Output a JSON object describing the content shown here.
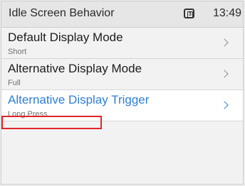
{
  "header": {
    "title": "Idle Screen Behavior",
    "line_badge": "3",
    "time": "13:49"
  },
  "settings": [
    {
      "label": "Default Display Mode",
      "value": "Short",
      "selected": false
    },
    {
      "label": "Alternative Display Mode",
      "value": "Full",
      "selected": false
    },
    {
      "label": "Alternative Display Trigger",
      "value": "Long Press",
      "selected": true
    }
  ],
  "colors": {
    "accent": "#2f7fd0",
    "highlight_border": "#e0252a"
  },
  "icons": {
    "line": "phone-line-icon",
    "chevron": "chevron-right-icon"
  }
}
